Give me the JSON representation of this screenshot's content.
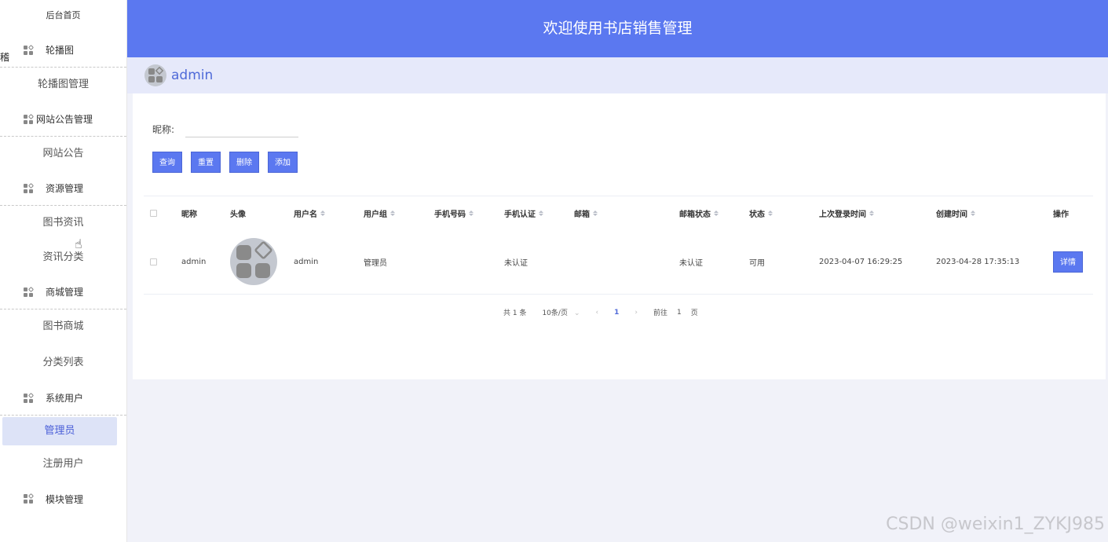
{
  "sidebar": {
    "home": "后台首页",
    "stub": "稽",
    "groups": [
      {
        "label": "轮播图",
        "items": [
          "轮播图管理"
        ]
      },
      {
        "label": "网站公告管理",
        "items": [
          "网站公告"
        ]
      },
      {
        "label": "资源管理",
        "items": [
          "图书资讯",
          "资讯分类"
        ]
      },
      {
        "label": "商城管理",
        "items": [
          "图书商城",
          "分类列表"
        ]
      },
      {
        "label": "系统用户",
        "items": [
          "管理员",
          "注册用户"
        ]
      },
      {
        "label": "模块管理",
        "items": []
      }
    ]
  },
  "header": {
    "title": "欢迎使用书店销售管理"
  },
  "userbar": {
    "username": "admin"
  },
  "search": {
    "label": "昵称:",
    "value": "",
    "placeholder": ""
  },
  "buttons": {
    "query": "查询",
    "reset": "重置",
    "delete": "删除",
    "add": "添加"
  },
  "table": {
    "columns": [
      "昵称",
      "头像",
      "用户名",
      "用户组",
      "手机号码",
      "手机认证",
      "邮箱",
      "邮箱状态",
      "状态",
      "上次登录时间",
      "创建时间",
      "操作"
    ],
    "rows": [
      {
        "nickname": "admin",
        "username": "admin",
        "group": "管理员",
        "phone": "",
        "phone_verify": "未认证",
        "email": "",
        "email_status": "未认证",
        "status": "可用",
        "last_login": "2023-04-07 16:29:25",
        "created": "2023-04-28 17:35:13",
        "action": "详情"
      }
    ]
  },
  "pager": {
    "total": "共 1 条",
    "page_size": "10条/页",
    "current": "1",
    "goto_label": "前往",
    "goto_value": "1",
    "page_unit": "页"
  },
  "watermark": "CSDN @weixin1_ZYKJ985",
  "colors": {
    "primary": "#5b78f0",
    "active_bg": "#dde3f7",
    "userbar_bg": "#e6e9fa"
  }
}
